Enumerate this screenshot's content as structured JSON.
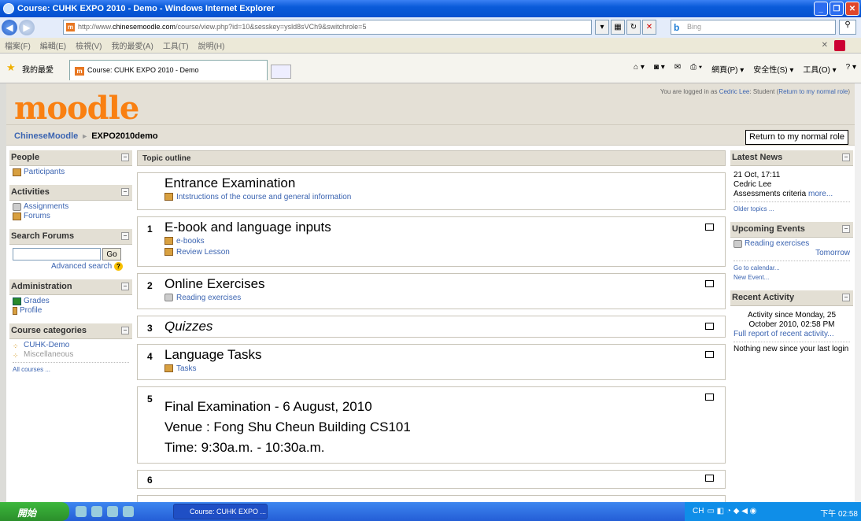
{
  "window": {
    "title": "Course: CUHK EXPO 2010 - Demo - Windows Internet Explorer"
  },
  "address": {
    "url_prefix": "http://www.",
    "url_host": "chinesemoodle.com",
    "url_path": "/course/view.php?id=10&sesskey=ysld8sVCh9&switchrole=5",
    "search_placeholder": "Bing"
  },
  "menu": [
    "檔案(F)",
    "編輯(E)",
    "檢視(V)",
    "我的最愛(A)",
    "工具(T)",
    "說明(H)"
  ],
  "favbar": {
    "favorites": "我的最愛",
    "tab_title": "Course: CUHK EXPO 2010 - Demo",
    "tools": [
      "網頁(P) ▾",
      "安全性(S) ▾",
      "工具(O) ▾"
    ]
  },
  "header": {
    "logo": "moodle",
    "login_prefix": "You are logged in as ",
    "login_user": "Cedric Lee",
    "login_mid": ": Student (",
    "login_return": "Return to my normal role",
    "login_suffix": ")"
  },
  "nav": {
    "home": "ChineseMoodle",
    "sep": "►",
    "course": "EXPO2010demo",
    "role_button": "Return to my normal role"
  },
  "left": {
    "people_title": "People",
    "participants": "Participants",
    "activities_title": "Activities",
    "assignments": "Assignments",
    "forums": "Forums",
    "search_title": "Search Forums",
    "go": "Go",
    "advanced": "Advanced search",
    "admin_title": "Administration",
    "grades": "Grades",
    "profile": "Profile",
    "categories_title": "Course categories",
    "cat1": "CUHK-Demo",
    "cat2": "Miscellaneous",
    "all_courses": "All courses ..."
  },
  "main": {
    "topic_outline": "Topic outline",
    "sec0_title": "Entrance Examination",
    "sec0_link": "Intstructions of the course and general information",
    "sec1_num": "1",
    "sec1_title": "E-book and language inputs",
    "sec1_link1": "e-books",
    "sec1_link2": "Review Lesson",
    "sec2_num": "2",
    "sec2_title": "Online Exercises",
    "sec2_link": "Reading exercises",
    "sec3_num": "3",
    "sec3_title": "Quizzes",
    "sec4_num": "4",
    "sec4_title": "Language Tasks",
    "sec4_link": "Tasks",
    "sec5_num": "5",
    "sec5_line1": "Final Examination - 6 August, 2010",
    "sec5_line2": "Venue : Fong Shu Cheun Building CS101",
    "sec5_line3": "Time: 9:30a.m. - 10:30a.m.",
    "sec6_num": "6"
  },
  "right": {
    "news_title": "Latest News",
    "news_date": "21 Oct, 17:11",
    "news_author": "Cedric Lee",
    "news_text": "Assessments criteria ",
    "news_more": "more...",
    "news_older": "Older topics ...",
    "events_title": "Upcoming Events",
    "event_name": "Reading exercises",
    "event_when": "Tomorrow",
    "calendar": "Go to calendar...",
    "new_event": "New Event...",
    "recent_title": "Recent Activity",
    "recent_since": "Activity since Monday, 25 October 2010, 02:58 PM",
    "recent_full": "Full report of recent activity...",
    "recent_none": "Nothing new since your last login"
  },
  "taskbar": {
    "start": "開始",
    "task": "Course: CUHK EXPO ...",
    "ime": "CH",
    "clock": "下午 02:58"
  }
}
